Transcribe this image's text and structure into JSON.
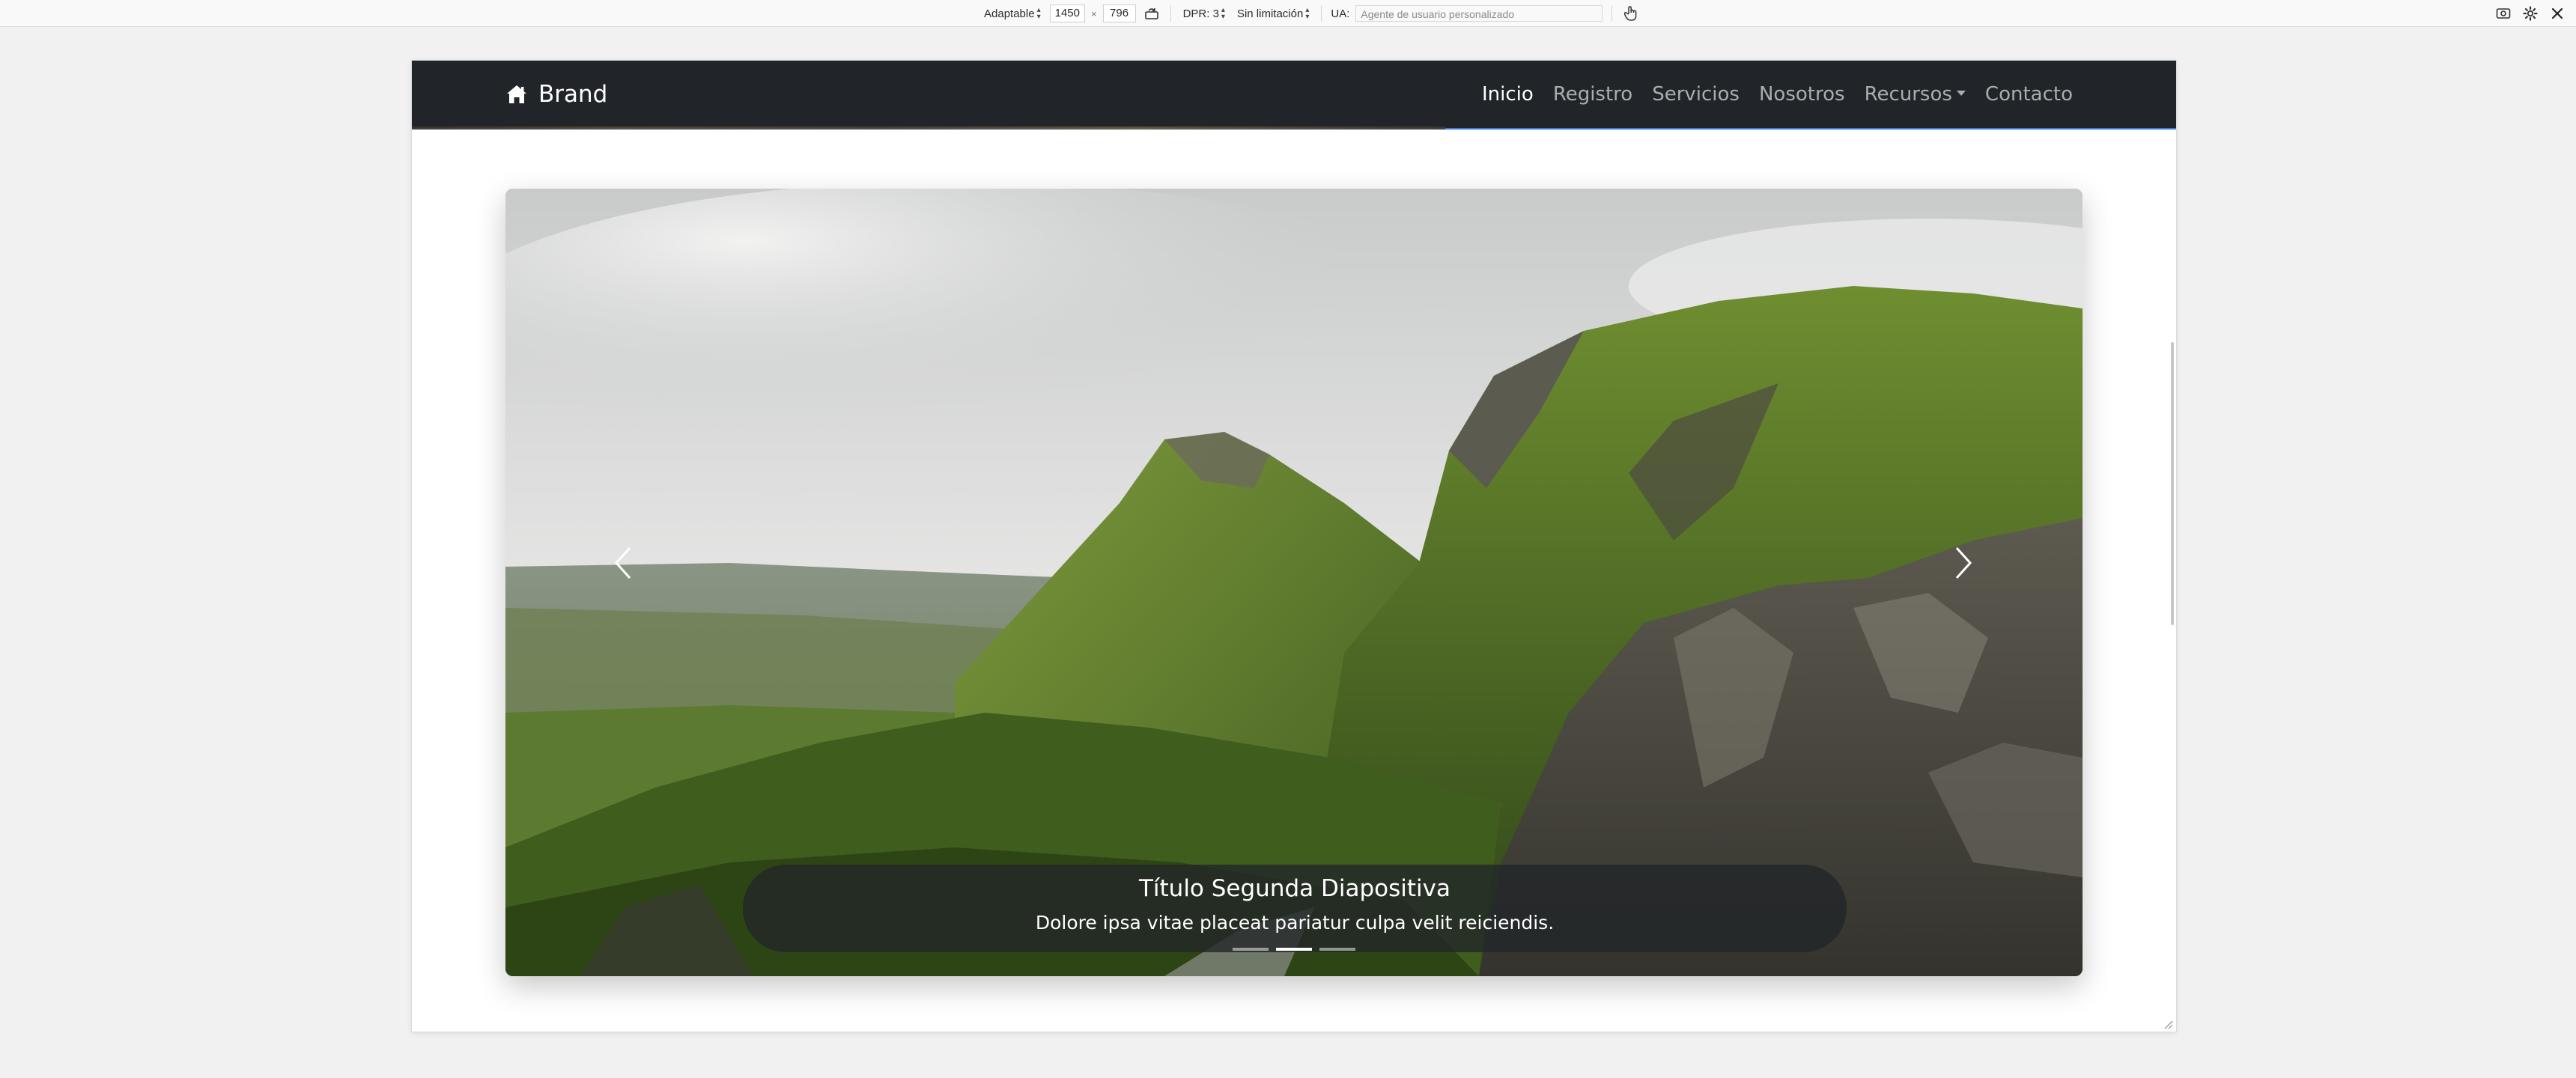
{
  "toolbar": {
    "device_label": "Adaptable",
    "width": "1450",
    "height": "796",
    "times_symbol": "×",
    "dpr_label": "DPR: 3",
    "throttle_label": "Sin limitación",
    "ua_label": "UA:",
    "ua_placeholder": "Agente de usuario personalizado",
    "icons": [
      "rotate-icon",
      "touch-icon",
      "screenshot-icon",
      "settings-icon",
      "close-icon"
    ]
  },
  "navbar": {
    "brand_icon": "home-icon",
    "brand": "Brand",
    "links": [
      "Inicio",
      "Registro",
      "Servicios",
      "Nosotros",
      "Recursos",
      "Contacto"
    ],
    "active_index": 0,
    "dropdown_index": 4,
    "background": "#212529"
  },
  "carousel": {
    "caption_title": "Título Segunda Diapositiva",
    "caption_text": "Dolore ipsa vitae placeat pariatur culpa velit reiciendis.",
    "slide_count": 3,
    "active_slide": 2,
    "prev_icon": "chevron-left-icon",
    "next_icon": "chevron-right-icon"
  }
}
